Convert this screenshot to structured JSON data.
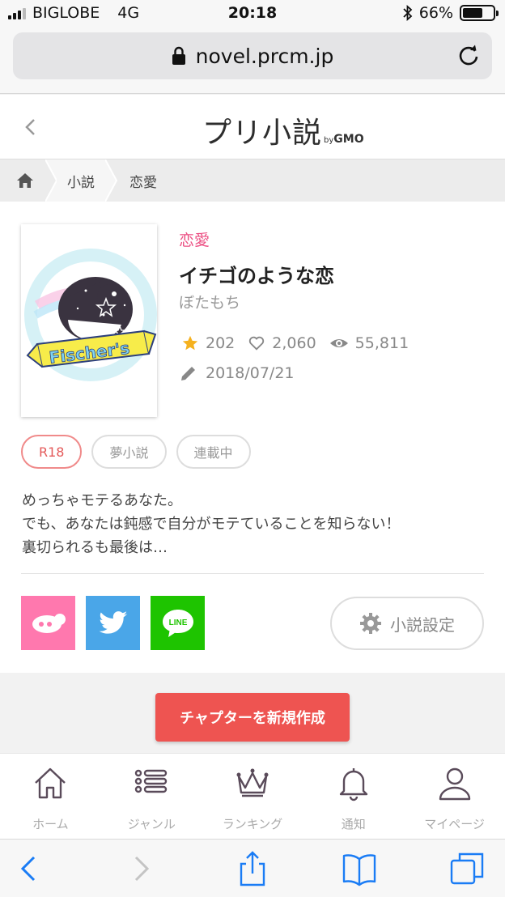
{
  "status_bar": {
    "carrier": "BIGLOBE",
    "network": "4G",
    "time": "20:18",
    "battery": "66%",
    "battery_level": 0.66
  },
  "browser": {
    "url": "novel.prcm.jp"
  },
  "site": {
    "logo_main": "プリ小説",
    "logo_by": "by",
    "logo_gmo": "GMO"
  },
  "breadcrumb": {
    "items": [
      "小説",
      "恋愛"
    ]
  },
  "novel": {
    "genre": "恋愛",
    "title": "イチゴのような恋",
    "author": "ぼたもち",
    "stars": "202",
    "likes": "2,060",
    "views": "55,811",
    "date": "2018/07/21",
    "tags": [
      "R18",
      "夢小説",
      "連載中"
    ],
    "description": [
      "めっちゃモテるあなた。",
      "でも、あなたは鈍感で自分がモテていることを知らない！",
      "裏切られるも最後は…"
    ]
  },
  "cover": {
    "banner_text": "Fischer's"
  },
  "actions": {
    "settings_label": "小説設定",
    "new_chapter_label": "チャプターを新規作成"
  },
  "bottom_nav": {
    "items": [
      {
        "label": "ホーム",
        "icon": "home-icon"
      },
      {
        "label": "ジャンル",
        "icon": "list-icon"
      },
      {
        "label": "ランキング",
        "icon": "crown-icon"
      },
      {
        "label": "通知",
        "icon": "bell-icon"
      },
      {
        "label": "マイページ",
        "icon": "person-icon"
      }
    ]
  },
  "colors": {
    "accent_pink": "#ec4f83",
    "new_chapter_red": "#ee5451",
    "share_pink": "#ff78ae",
    "twitter_blue": "#4aa6e8",
    "line_green": "#1ec400",
    "star_gold": "#f5b11e",
    "ios_blue": "#1a7cf5"
  }
}
